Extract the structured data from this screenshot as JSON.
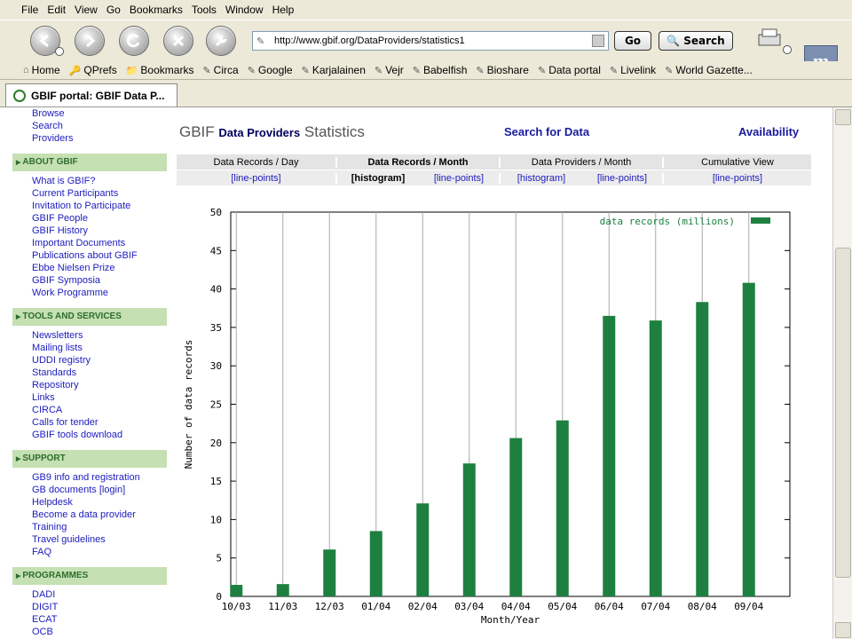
{
  "menu": [
    "File",
    "Edit",
    "View",
    "Go",
    "Bookmarks",
    "Tools",
    "Window",
    "Help"
  ],
  "url": "http://www.gbif.org/DataProviders/statistics1",
  "go_label": "Go",
  "search_label": "Search",
  "bookmarks": [
    "Home",
    "QPrefs",
    "Bookmarks",
    "Circa",
    "Google",
    "Karjalainen",
    "Vejr",
    "Babelfish",
    "Bioshare",
    "Data portal",
    "Livelink",
    "World Gazette..."
  ],
  "tab_title": "GBIF portal: GBIF Data P...",
  "sidebar": {
    "top_links": [
      "Browse",
      "Search",
      "Providers"
    ],
    "sections": [
      {
        "title": "ABOUT GBIF",
        "items": [
          "What is GBIF?",
          "Current Participants",
          "Invitation to Participate",
          "GBIF People",
          "GBIF History",
          "Important Documents",
          "Publications about GBIF",
          "Ebbe Nielsen Prize",
          "GBIF Symposia",
          "Work Programme"
        ]
      },
      {
        "title": "TOOLS AND SERVICES",
        "items": [
          "Newsletters",
          "Mailing lists",
          "UDDI registry",
          "Standards",
          "Repository",
          "Links",
          "CIRCA",
          "Calls for tender",
          "GBIF tools download"
        ]
      },
      {
        "title": "SUPPORT",
        "items": [
          "GB9 info and registration",
          "GB documents [login]",
          "Helpdesk",
          "Become a data provider",
          "Training",
          "Travel guidelines",
          "FAQ"
        ]
      },
      {
        "title": "PROGRAMMES",
        "items": [
          "DADI",
          "DIGIT",
          "ECAT",
          "OCB"
        ]
      }
    ]
  },
  "header": {
    "gbif": "GBIF",
    "data_providers": "Data Providers",
    "statistics": "Statistics",
    "search_for_data": "Search for Data",
    "availability": "Availability"
  },
  "stats_nav": {
    "headers": [
      "Data Records / Day",
      "Data Records / Month",
      "Data Providers / Month",
      "Cumulative View"
    ],
    "links": [
      "[line-points]",
      "[histogram]",
      "[line-points]",
      "[histogram]",
      "[line-points]",
      "[line-points]"
    ]
  },
  "chart_data": {
    "type": "bar",
    "categories": [
      "10/03",
      "11/03",
      "12/03",
      "01/04",
      "02/04",
      "03/04",
      "04/04",
      "05/04",
      "06/04",
      "07/04",
      "08/04",
      "09/04"
    ],
    "series": [
      {
        "name": "data records (millions)",
        "values": [
          1.5,
          1.6,
          6.1,
          8.5,
          12.1,
          17.3,
          20.6,
          22.9,
          36.5,
          35.9,
          38.3,
          40.8
        ]
      }
    ],
    "xlabel": "Month/Year",
    "ylabel": "Number of data records",
    "ylim": [
      0,
      50
    ],
    "yticks": [
      0,
      5,
      10,
      15,
      20,
      25,
      30,
      35,
      40,
      45,
      50
    ],
    "color": "#1e8040",
    "grid": true,
    "legend_position": "top-right"
  }
}
